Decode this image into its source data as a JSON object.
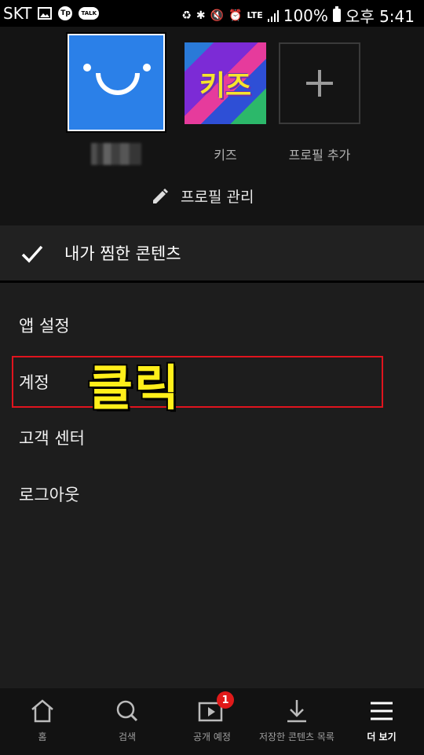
{
  "status_bar": {
    "carrier": "SKT",
    "battery": "100%",
    "time": "오후 5:41",
    "network": "LTE"
  },
  "profiles": [
    {
      "name": "",
      "icon": "smiley-avatar",
      "selected": true
    },
    {
      "name": "키즈",
      "icon": "kids-avatar",
      "avatar_text": "키즈"
    },
    {
      "name": "프로필 추가",
      "icon": "plus-icon"
    }
  ],
  "manage_profiles": "프로필 관리",
  "my_list": "내가 찜한 콘텐츠",
  "menu": {
    "app_settings": "앱 설정",
    "account": "계정",
    "customer_center": "고객 센터",
    "logout": "로그아웃"
  },
  "annotation": {
    "text": "클릭",
    "color": "#ffef1a",
    "box_color": "#e0141e"
  },
  "bottom_nav": [
    {
      "label": "홈",
      "icon": "home-icon"
    },
    {
      "label": "검색",
      "icon": "search-icon"
    },
    {
      "label": "공개 예정",
      "icon": "coming-soon-icon",
      "badge": "1"
    },
    {
      "label": "저장한 콘텐츠 목록",
      "icon": "download-icon"
    },
    {
      "label": "더 보기",
      "icon": "menu-icon",
      "active": true
    }
  ],
  "colors": {
    "background": "#1d1d1d",
    "netflix_blue": "#2b80e8",
    "badge_red": "#e01a1a"
  }
}
